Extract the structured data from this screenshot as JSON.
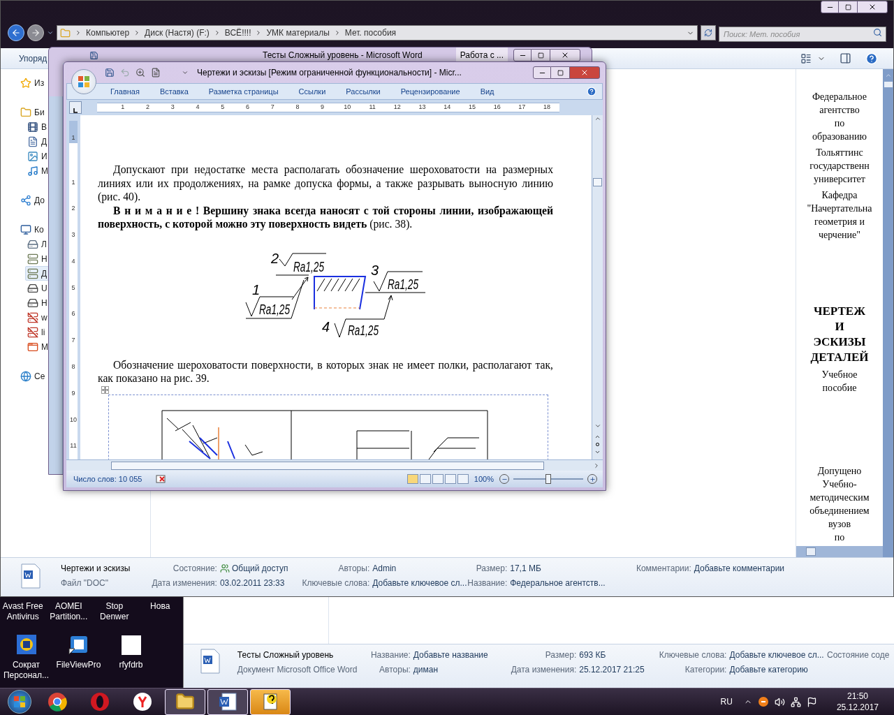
{
  "explorer": {
    "breadcrumbs": [
      "Компьютер",
      "Диск (Настя) (F:)",
      "ВСЁ!!!!",
      "УМК материалы",
      "Мет. пособия"
    ],
    "search": {
      "placeholder": "Поиск: Мет. пособия"
    },
    "toolbar_label": "Упоряд",
    "nav": [
      {
        "label": "Из",
        "kind": "star",
        "selected": false
      },
      {
        "label": "Би",
        "kind": "folder",
        "selected": false,
        "children": [
          {
            "label": "В",
            "kind": "film",
            "selected": false
          },
          {
            "label": "Д",
            "kind": "file",
            "selected": false
          },
          {
            "label": "И",
            "kind": "image",
            "selected": false
          },
          {
            "label": "М",
            "kind": "music",
            "selected": false
          }
        ]
      },
      {
        "label": "До",
        "kind": "homegroup",
        "selected": false
      },
      {
        "label": "Ко",
        "kind": "monitor",
        "selected": false,
        "children": [
          {
            "label": "Л",
            "kind": "system-disk",
            "selected": false
          },
          {
            "label": "Н",
            "kind": "net-disk",
            "selected": false
          },
          {
            "label": "Д",
            "kind": "net-disk",
            "selected": true
          },
          {
            "label": "U",
            "kind": "drive",
            "selected": false
          },
          {
            "label": "H",
            "kind": "drive",
            "selected": false
          },
          {
            "label": "w",
            "kind": "net-disk-off",
            "selected": false
          },
          {
            "label": "li",
            "kind": "net-disk-off",
            "selected": false
          },
          {
            "label": "M",
            "kind": "app",
            "selected": false
          }
        ]
      },
      {
        "label": "Се",
        "kind": "network",
        "selected": false
      }
    ],
    "preview": [
      {
        "kind": "text",
        "lines": [
          "Федеральное",
          "агентство",
          "по",
          "образованию"
        ]
      },
      {
        "kind": "text",
        "lines": [
          "Тольяттинс",
          "государственн",
          "университет"
        ]
      },
      {
        "kind": "text",
        "lines": [
          "Кафедра",
          "\"Начертательна",
          "геометрия и",
          "черчение\""
        ]
      },
      {
        "kind": "title",
        "lines": [
          "ЧЕРТЕЖ",
          "И",
          "ЭСКИЗЫ",
          "ДЕТАЛЕЙ"
        ]
      },
      {
        "kind": "text",
        "lines": [
          "Учебное",
          "пособие"
        ]
      },
      {
        "kind": "text",
        "lines": [
          "Допущено",
          "Учебно-",
          "методическим",
          "объединением",
          "вузов",
          "по"
        ]
      }
    ],
    "details": {
      "name": "Чертежи и эскизы",
      "type": "Файл \"DOC\"",
      "columns": [
        [
          {
            "label": "Состояние:",
            "value": "Общий доступ",
            "kind": "shared"
          },
          {
            "label": "Дата изменения:",
            "value": "03.02.2011 23:33",
            "kind": "plain"
          }
        ],
        [
          {
            "label": "Авторы:",
            "value": "Admin",
            "kind": "plain"
          },
          {
            "label": "Ключевые слова:",
            "value": "Добавьте ключевое сл...",
            "kind": "plain"
          }
        ],
        [
          {
            "label": "Размер:",
            "value": "17,1 МБ",
            "kind": "plain"
          },
          {
            "label": "Название:",
            "value": "Федеральное агентств...",
            "kind": "plain"
          }
        ],
        [
          {
            "label": "Комментарии:",
            "value": "Добавьте комментарии",
            "kind": "plain"
          }
        ]
      ]
    }
  },
  "explorer_2": {
    "details": {
      "name": "Тесты Сложный уровень",
      "type": "Документ Microsoft Office Word",
      "columns": [
        [
          {
            "label": "Название:",
            "value": "Добавьте название"
          },
          {
            "label": "Авторы:",
            "value": "диман"
          }
        ],
        [
          {
            "label": "Размер:",
            "value": "693 КБ"
          },
          {
            "label": "Дата изменения:",
            "value": "25.12.2017 21:25"
          }
        ],
        [
          {
            "label": "Ключевые слова:",
            "value": "Добавьте ключевое сл..."
          },
          {
            "label": "Категории:",
            "value": "Добавьте категорию"
          }
        ],
        [
          {
            "label": "Состояние соде"
          }
        ]
      ]
    }
  },
  "desktop_icons": [
    {
      "label": "Avast Free Antivirus",
      "kind": "hidden"
    },
    {
      "label": "AOMEI Partition...",
      "kind": "hidden"
    },
    {
      "label": "Stop Denwer",
      "kind": "hidden"
    },
    {
      "label": "Нова",
      "kind": "hidden"
    },
    {
      "label": "Сократ Персонал...",
      "kind": "app"
    },
    {
      "label": "FileViewPro",
      "kind": "shortcut"
    },
    {
      "label": "rfyfdrb",
      "kind": "blank"
    }
  ],
  "word_back": {
    "title": "Тесты Сложный уровень - Microsoft Word",
    "context_tab": "Работа с ..."
  },
  "word_front": {
    "title": "Чертежи и эскизы [Режим ограниченной функциональности] - Micr...",
    "tabs": [
      "Главная",
      "Вставка",
      "Разметка страницы",
      "Ссылки",
      "Рассылки",
      "Рецензирование",
      "Вид"
    ],
    "ruler_marks": [
      "1",
      "2",
      "3",
      "4",
      "5",
      "6",
      "7",
      "8",
      "9",
      "10",
      "11",
      "12",
      "13",
      "14",
      "15",
      "16",
      "17",
      "18"
    ],
    "vruler_margin_marks": [
      "1"
    ],
    "vruler_marks": [
      "1",
      "2",
      "3",
      "4",
      "5",
      "6",
      "7",
      "8",
      "9",
      "10",
      "11"
    ],
    "paragraphs": [
      "Допускают при недостатке места располагать обозначение шероховатости на размерных линиях или их продолжениях, на рамке допуска формы, а также разрывать выносную линию (рис. 40).",
      "**В н и м а н и е !  Вершину знака всегда наносят с той стороны линии, изображающей поверхность, с которой можно эту поверхность видеть** (рис. 38).",
      "Обозначение шероховатости поверхности, в которых знак не имеет полки, располагают так, как показано на рис. 39."
    ],
    "figure_callouts": [
      {
        "number": "2",
        "value": "Ra1,25"
      },
      {
        "number": "3",
        "value": "Ra1,25"
      },
      {
        "number": "1",
        "value": "Ra1,25"
      },
      {
        "number": "4",
        "value": "Ra1,25"
      }
    ],
    "status": {
      "word_count": "Число слов: 10 055",
      "zoom": {
        "reading": "100%",
        "level": 0.5
      }
    }
  },
  "taskbar": {
    "items": [
      {
        "kind": "start",
        "open": false,
        "flashing": false
      },
      {
        "kind": "chrome",
        "open": false,
        "flashing": false
      },
      {
        "kind": "opera",
        "open": false,
        "flashing": false
      },
      {
        "kind": "yandex",
        "open": false,
        "flashing": false
      },
      {
        "kind": "explorer",
        "open": true,
        "flashing": false
      },
      {
        "kind": "word",
        "open": true,
        "flashing": false
      },
      {
        "kind": "help",
        "open": true,
        "flashing": true
      }
    ],
    "language": "RU",
    "time": "21:50",
    "date": "25.12.2017"
  }
}
